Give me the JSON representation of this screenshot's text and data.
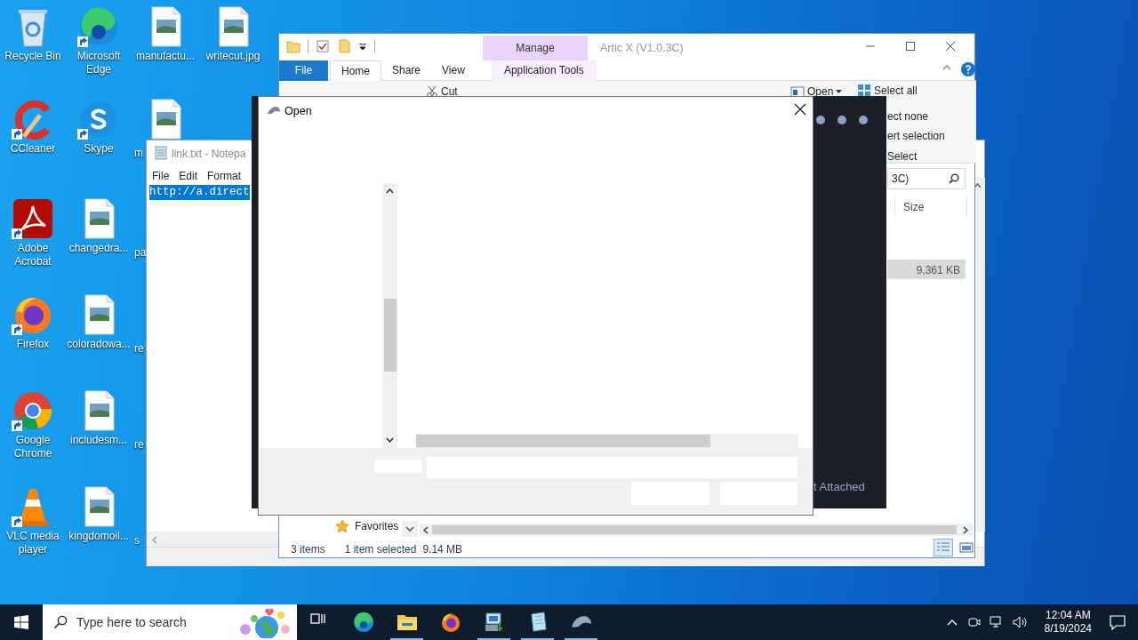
{
  "desktop_columns": [
    {
      "icons": [
        {
          "label": "Recycle Bin",
          "kind": "recycle-bin",
          "shortcut": false,
          "cut": false
        },
        {
          "label": "CCleaner",
          "kind": "ccleaner",
          "shortcut": true,
          "cut": false
        },
        {
          "label": "Adobe Acrobat",
          "kind": "acrobat",
          "shortcut": true,
          "cut": false
        },
        {
          "label": "Firefox",
          "kind": "firefox",
          "shortcut": true,
          "cut": false
        },
        {
          "label": "Google Chrome",
          "kind": "chrome",
          "shortcut": true,
          "cut": false
        },
        {
          "label": "VLC media player",
          "kind": "vlc",
          "shortcut": true,
          "cut": false
        }
      ]
    },
    {
      "icons": [
        {
          "label": "Microsoft Edge",
          "kind": "edge",
          "shortcut": true,
          "cut": false
        },
        {
          "label": "Skype",
          "kind": "skype",
          "shortcut": true,
          "cut": false
        },
        {
          "label": "changedra...",
          "kind": "image",
          "shortcut": false,
          "cut": false
        },
        {
          "label": "coloradowa...",
          "kind": "image",
          "shortcut": false,
          "cut": false
        },
        {
          "label": "includesm...",
          "kind": "image",
          "shortcut": false,
          "cut": false
        },
        {
          "label": "kingdomoil...",
          "kind": "image",
          "shortcut": false,
          "cut": false
        }
      ]
    },
    {
      "icons": [
        {
          "label": "manufactu...",
          "kind": "image",
          "shortcut": false,
          "cut": false
        },
        {
          "label": "m",
          "kind": "image",
          "shortcut": false,
          "cut": true
        },
        {
          "label": "pa",
          "kind": "covered",
          "shortcut": false,
          "cut": true
        },
        {
          "label": "re",
          "kind": "covered",
          "shortcut": false,
          "cut": true
        },
        {
          "label": "re",
          "kind": "covered",
          "shortcut": false,
          "cut": true
        },
        {
          "label": "s",
          "kind": "covered",
          "shortcut": false,
          "cut": true
        }
      ]
    },
    {
      "icons": [
        {
          "label": "writecut.jpg",
          "kind": "image",
          "shortcut": false,
          "cut": false
        }
      ]
    }
  ],
  "notepad": {
    "title": "link.txt - Notepa",
    "menu": [
      "File",
      "Edit",
      "Format"
    ],
    "text": "http://a.direct",
    "text_selected": true
  },
  "explorer": {
    "title": "Artic X (V1.0.3C)",
    "context_tab": "Manage",
    "tabs": [
      {
        "label": "File",
        "kind": "file",
        "selected": false
      },
      {
        "label": "Home",
        "kind": "plain",
        "selected": true
      },
      {
        "label": "Share",
        "kind": "plain",
        "selected": false
      },
      {
        "label": "View",
        "kind": "plain",
        "selected": false
      },
      {
        "label": "Application Tools",
        "kind": "context",
        "selected": false
      }
    ],
    "ribbon": [
      {
        "label": "Cut",
        "kind": "cut"
      },
      {
        "label": "Open",
        "kind": "open"
      },
      {
        "label": "Select all",
        "kind": "select-all"
      },
      {
        "label": "ect none",
        "kind": "partial"
      },
      {
        "label": "ert selection",
        "kind": "partial"
      },
      {
        "label": "Select",
        "kind": "partial"
      }
    ],
    "search": "3C)",
    "column": "Size",
    "rows": [
      {
        "size": "9,361 KB",
        "selected": true
      }
    ],
    "nav": "Favorites",
    "status": [
      "3 items",
      "1 item selected",
      "9.14 MB"
    ]
  },
  "dark_app": {
    "status": "t Attached"
  },
  "open_dialog": {
    "title": "Open"
  },
  "taskbar": {
    "search_placeholder": "Type here to search",
    "apps": [
      {
        "kind": "task-view",
        "running": false
      },
      {
        "kind": "edge",
        "running": false
      },
      {
        "kind": "folder",
        "running": true
      },
      {
        "kind": "firefox",
        "running": false
      },
      {
        "kind": "installer",
        "running": true
      },
      {
        "kind": "notepad",
        "running": true
      },
      {
        "kind": "dolphin",
        "running": true
      }
    ],
    "time": "12:04 AM",
    "date": "8/19/2024"
  }
}
